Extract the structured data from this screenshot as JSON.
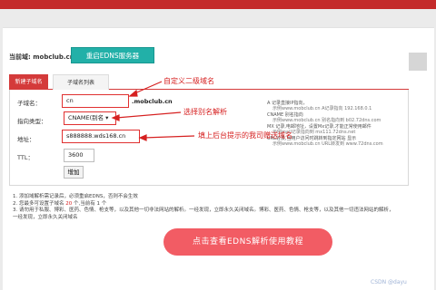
{
  "header": {
    "domain_label": "当前域: mobclub.cn",
    "restart_button": "重启EDNS服务器"
  },
  "tabs": [
    {
      "label": "新建子域名",
      "active": true
    },
    {
      "label": "子域名列表",
      "active": false
    }
  ],
  "form": {
    "subdomain_label": "子域名：",
    "subdomain_value": "cn",
    "subdomain_suffix": ".mobclub.cn",
    "type_label": "指向类型：",
    "type_value": "CNAME(别名 ▾",
    "address_label": "地址：",
    "address_value": "s888888.wds168.cn",
    "ttl_label": "TTL：",
    "ttl_value": "3600",
    "add_button": "增加"
  },
  "annotations": {
    "custom_subdomain": "自定义二级域名",
    "choose_alias": "选择别名解析",
    "fill_domain": "填上后台提示的我司赠送域名"
  },
  "hints": [
    "A 记录直接IP指向，",
    "示例www.mobclub.cn A记录指向 192.168.0.1",
    "CNAME 别名指向",
    "示例www.mobclub.cn 别名指向到 b02.72dns.com",
    "MX 记录,电邮地址，设置Mx记录,才能正常使用邮件",
    "示例mail记录指向到 mx111.72dns.net",
    "URL转发,当用户访问时跳转到指定网站 显示",
    "示例www.mobclub.cn URL转发到 www.72dns.com"
  ],
  "notes": {
    "line1": "1. 添加域解析需记录后，必须重启EDNS，否则不会生效",
    "line2_prefix": "2. 您最多可设置子域名 ",
    "line2_highlight": "20",
    "line2_suffix": " 个,当前有 1 个",
    "line3": "3. 请勿用于私服、博彩、医药、色情、枪支等，以及其他一切非法网站的解析。一经发现，立即永久关闭域名。博彩、医药、色情、枪支等，以及其他一切违法网站的解析，",
    "line4": "一经发现，立即永久关闭域名"
  },
  "cta_button": "点击查看EDNS解析使用教程",
  "watermark": "CSDN @dayu",
  "colors": {
    "top_bar": "#c42a2a",
    "teal_button": "#22b0a8",
    "active_tab": "#d43a3a",
    "annotation_red": "#d62020",
    "cta": "#f25c64"
  }
}
